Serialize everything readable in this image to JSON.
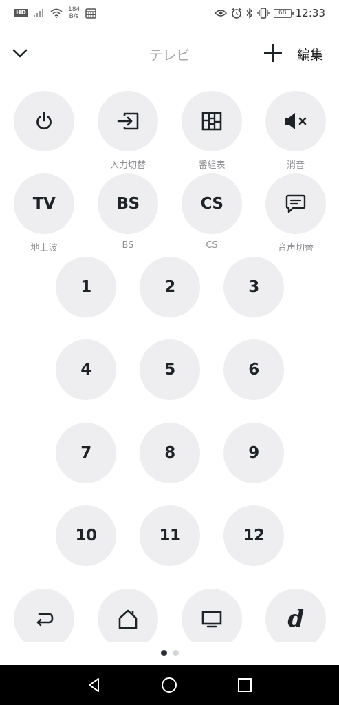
{
  "status_bar": {
    "hd_badge": "HD",
    "net_speed_value": "184",
    "net_speed_unit": "B/s",
    "battery_level": "68",
    "time": "12:33"
  },
  "header": {
    "title": "テレビ",
    "edit_label": "編集"
  },
  "function_keys": [
    {
      "label": ""
    },
    {
      "label": "入力切替"
    },
    {
      "label": "番組表"
    },
    {
      "label": "消音"
    }
  ],
  "broadcast_keys": [
    {
      "text": "TV",
      "label": "地上波"
    },
    {
      "text": "BS",
      "label": "BS"
    },
    {
      "text": "CS",
      "label": "CS"
    },
    {
      "text": "",
      "label": "音声切替"
    }
  ],
  "number_keys": [
    "1",
    "2",
    "3",
    "4",
    "5",
    "6",
    "7",
    "8",
    "9",
    "10",
    "11",
    "12"
  ],
  "bottom_keys": [
    {
      "icon": "return-icon"
    },
    {
      "icon": "home-icon"
    },
    {
      "icon": "screen-icon"
    },
    {
      "text": "d"
    }
  ],
  "pagination": {
    "pages": 2,
    "current": 1
  },
  "colors": {
    "button_bg": "#eeeef0",
    "icon": "#1f2326",
    "label": "#8e8e93",
    "title": "#a8a8ad"
  }
}
